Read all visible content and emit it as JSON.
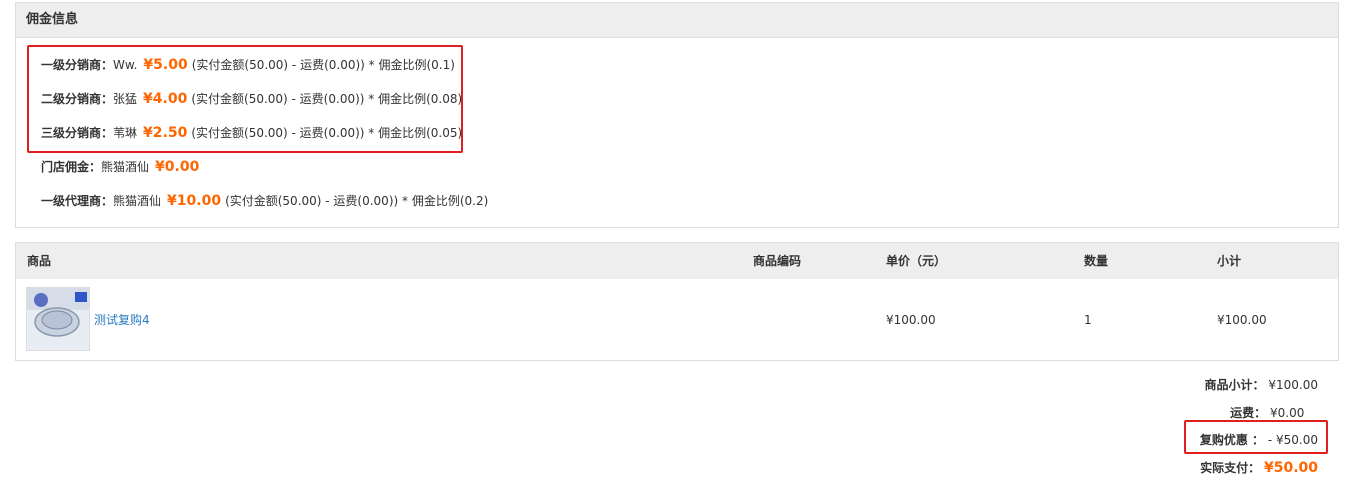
{
  "commission": {
    "title": "佣金信息",
    "rows": [
      {
        "label": "一级分销商：",
        "name": "Ww.",
        "amount": "¥5.00",
        "formula": "(实付金额(50.00) - 运费(0.00)) * 佣金比例(0.1)"
      },
      {
        "label": "二级分销商：",
        "name": "张猛",
        "amount": "¥4.00",
        "formula": "(实付金额(50.00) - 运费(0.00)) * 佣金比例(0.08)"
      },
      {
        "label": "三级分销商：",
        "name": "苇琳",
        "amount": "¥2.50",
        "formula": "(实付金额(50.00) - 运费(0.00)) * 佣金比例(0.05)"
      },
      {
        "label": "门店佣金：",
        "name": "熊猫酒仙",
        "amount": "¥0.00",
        "formula": ""
      },
      {
        "label": "一级代理商：",
        "name": "熊猫酒仙",
        "amount": "¥10.00",
        "formula": "(实付金额(50.00) - 运费(0.00)) * 佣金比例(0.2)"
      }
    ]
  },
  "goods": {
    "headers": {
      "product": "商品",
      "code": "商品编码",
      "price": "单价（元）",
      "qty": "数量",
      "subtotal": "小计"
    },
    "items": [
      {
        "name": "测试复购4",
        "code": "",
        "price": "¥100.00",
        "qty": "1",
        "subtotal": "¥100.00"
      }
    ]
  },
  "totals": {
    "subtotal_label": "商品小计：",
    "subtotal_value": "¥100.00",
    "shipping_label": "运费：",
    "shipping_value": "¥0.00",
    "discount_label": "复购优惠 ：",
    "discount_value": "- ¥50.00",
    "paid_label": "实际支付：",
    "paid_value": "¥50.00"
  },
  "colors": {
    "accent": "#ff6600",
    "highlight": "#e02020",
    "link": "#2a7ac0"
  }
}
